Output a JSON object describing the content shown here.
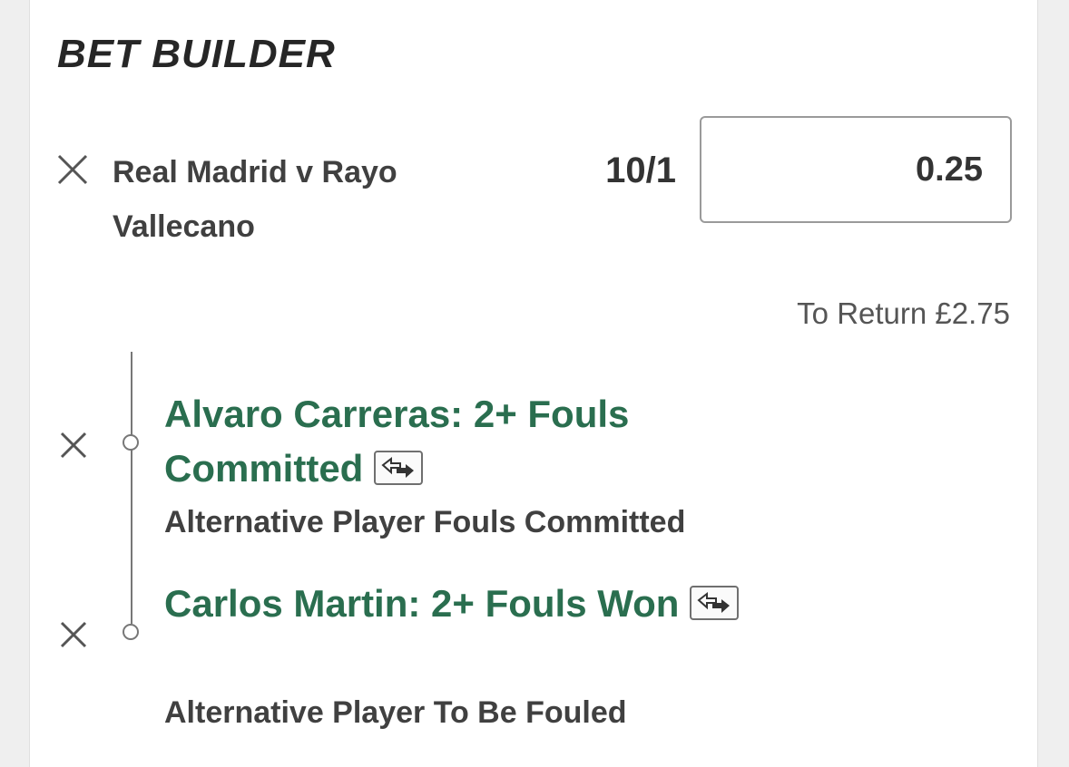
{
  "header": {
    "title": "BET BUILDER"
  },
  "bet": {
    "event_name": "Real Madrid v Rayo Vallecano",
    "odds": "10/1",
    "stake": "0.25",
    "to_return": "To Return £2.75"
  },
  "selections": [
    {
      "title": "Alvaro Carreras: 2+ Fouls Committed",
      "market": "Alternative Player Fouls Committed",
      "icon": "swap-icon"
    },
    {
      "title": "Carlos Martin: 2+ Fouls Won",
      "market": "Alternative Player To Be Fouled",
      "icon": "swap-icon"
    }
  ],
  "colors": {
    "selection_green": "#2a6e4f",
    "text_dark": "#404040",
    "background": "#efefef"
  }
}
